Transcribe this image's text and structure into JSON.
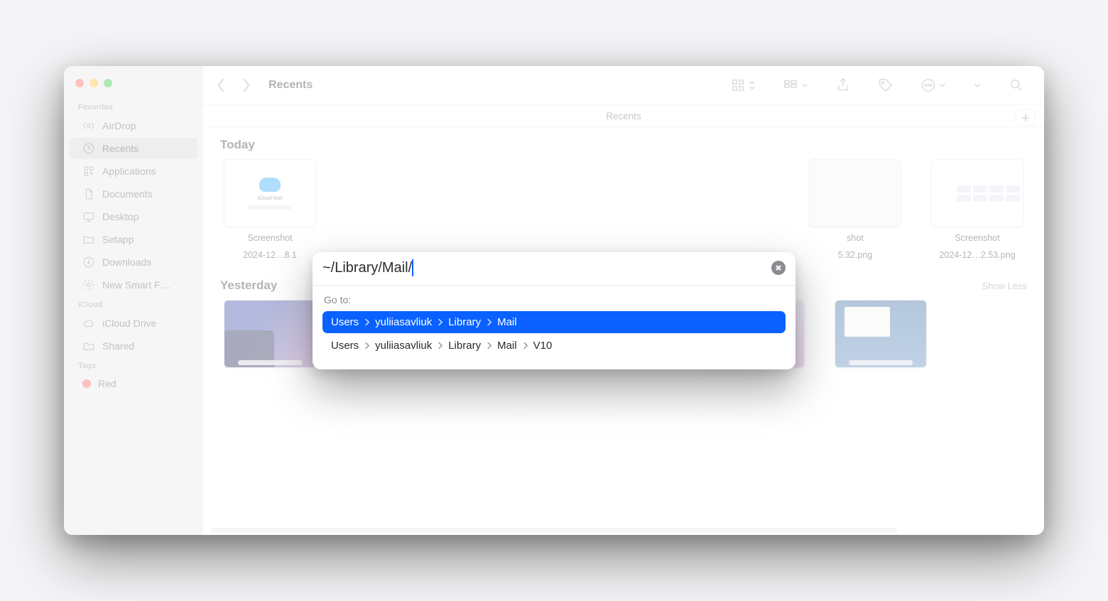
{
  "window": {
    "title": "Recents",
    "subheader": "Recents"
  },
  "sidebar": {
    "favorites_label": "Favorites",
    "items": [
      {
        "label": "AirDrop",
        "icon": "airdrop"
      },
      {
        "label": "Recents",
        "icon": "clock",
        "active": true
      },
      {
        "label": "Applications",
        "icon": "apps"
      },
      {
        "label": "Documents",
        "icon": "doc"
      },
      {
        "label": "Desktop",
        "icon": "desktop"
      },
      {
        "label": "Setapp",
        "icon": "folder"
      },
      {
        "label": "Downloads",
        "icon": "download"
      },
      {
        "label": "New Smart F…",
        "icon": "gear"
      }
    ],
    "icloud_label": "iCloud",
    "icloud_items": [
      {
        "label": "iCloud Drive",
        "icon": "cloud"
      },
      {
        "label": "Shared",
        "icon": "folder"
      }
    ],
    "tags_label": "Tags",
    "tags": [
      {
        "label": "Red",
        "color": "#ff5b5b"
      }
    ]
  },
  "groups": {
    "today": "Today",
    "yesterday": "Yesterday",
    "show_less": "Show Less"
  },
  "files_today": [
    {
      "line1": "Screenshot",
      "line2": "2024-12…8.1"
    },
    {
      "line1": "shot",
      "line2": "5.32.png"
    },
    {
      "line1": "Screenshot",
      "line2": "2024-12…2.53.png"
    }
  ],
  "dialog": {
    "input_value": "~/Library/Mail/",
    "goto_label": "Go to:",
    "clear_label": "Clear",
    "results": [
      {
        "segments": [
          "Users",
          "yuliiasavliuk",
          "Library",
          "Mail"
        ],
        "selected": true
      },
      {
        "segments": [
          "Users",
          "yuliiasavliuk",
          "Library",
          "Mail",
          "V10"
        ],
        "selected": false
      }
    ]
  }
}
